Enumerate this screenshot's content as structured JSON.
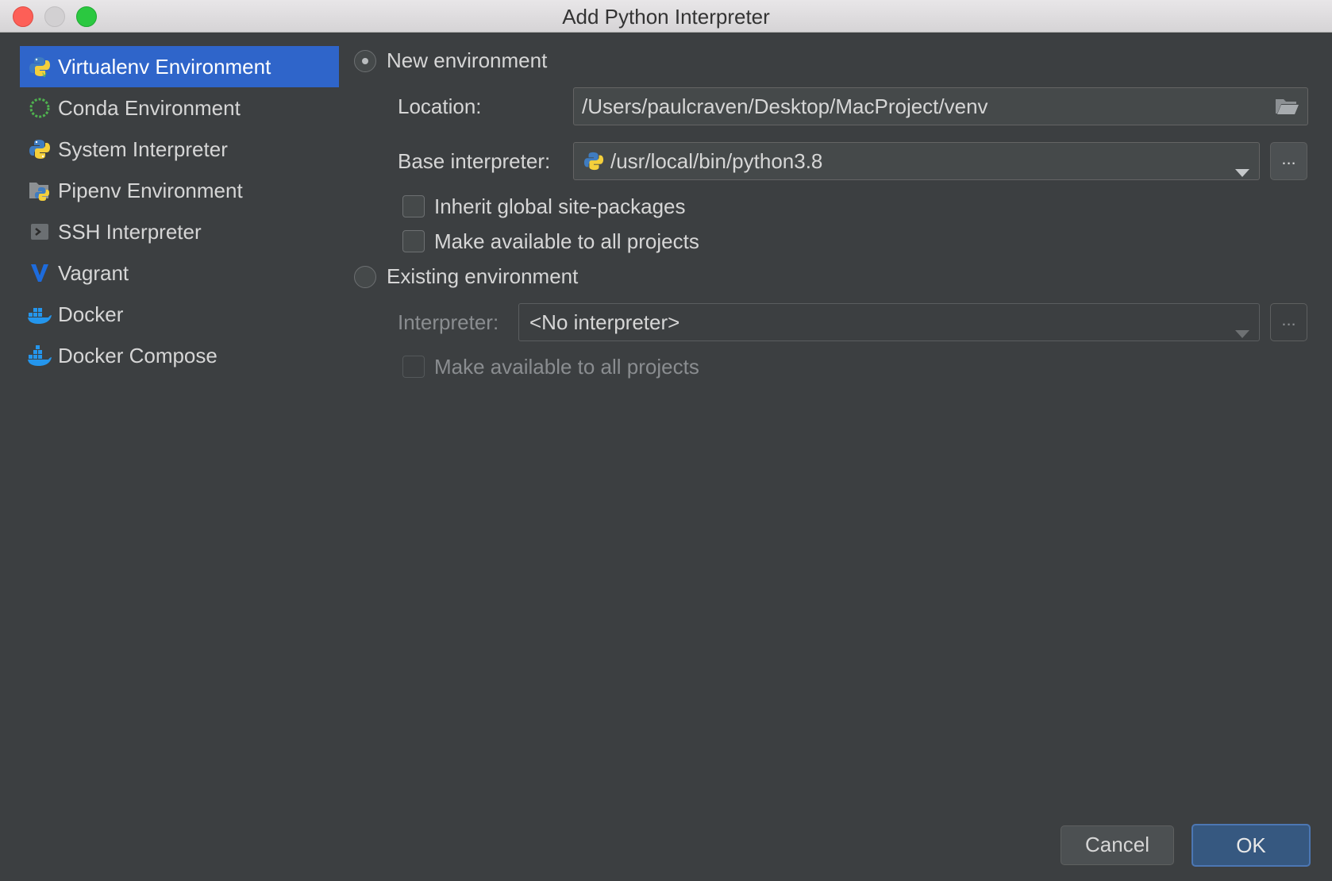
{
  "window": {
    "title": "Add Python Interpreter"
  },
  "sidebar": {
    "items": [
      {
        "label": "Virtualenv Environment",
        "icon": "python-venv-icon",
        "selected": true
      },
      {
        "label": "Conda Environment",
        "icon": "conda-icon",
        "selected": false
      },
      {
        "label": "System Interpreter",
        "icon": "python-icon",
        "selected": false
      },
      {
        "label": "Pipenv Environment",
        "icon": "pipenv-icon",
        "selected": false
      },
      {
        "label": "SSH Interpreter",
        "icon": "terminal-icon",
        "selected": false
      },
      {
        "label": "Vagrant",
        "icon": "vagrant-icon",
        "selected": false
      },
      {
        "label": "Docker",
        "icon": "docker-icon",
        "selected": false
      },
      {
        "label": "Docker Compose",
        "icon": "docker-compose-icon",
        "selected": false
      }
    ]
  },
  "new_env": {
    "radio_label": "New environment",
    "selected": true,
    "location_label": "Location:",
    "location_value": "/Users/paulcraven/Desktop/MacProject/venv",
    "base_label": "Base interpreter:",
    "base_value": "/usr/local/bin/python3.8",
    "browse_label": "...",
    "inherit_label": "Inherit global site-packages",
    "inherit_checked": false,
    "available_label": "Make available to all projects",
    "available_checked": false
  },
  "existing_env": {
    "radio_label": "Existing environment",
    "selected": false,
    "interpreter_label": "Interpreter:",
    "interpreter_value": "<No interpreter>",
    "browse_label": "...",
    "available_label": "Make available to all projects",
    "available_checked": false
  },
  "footer": {
    "cancel_label": "Cancel",
    "ok_label": "OK"
  },
  "colors": {
    "background": "#3c3f41",
    "selection": "#2f65ca",
    "ok_button": "#365880"
  }
}
